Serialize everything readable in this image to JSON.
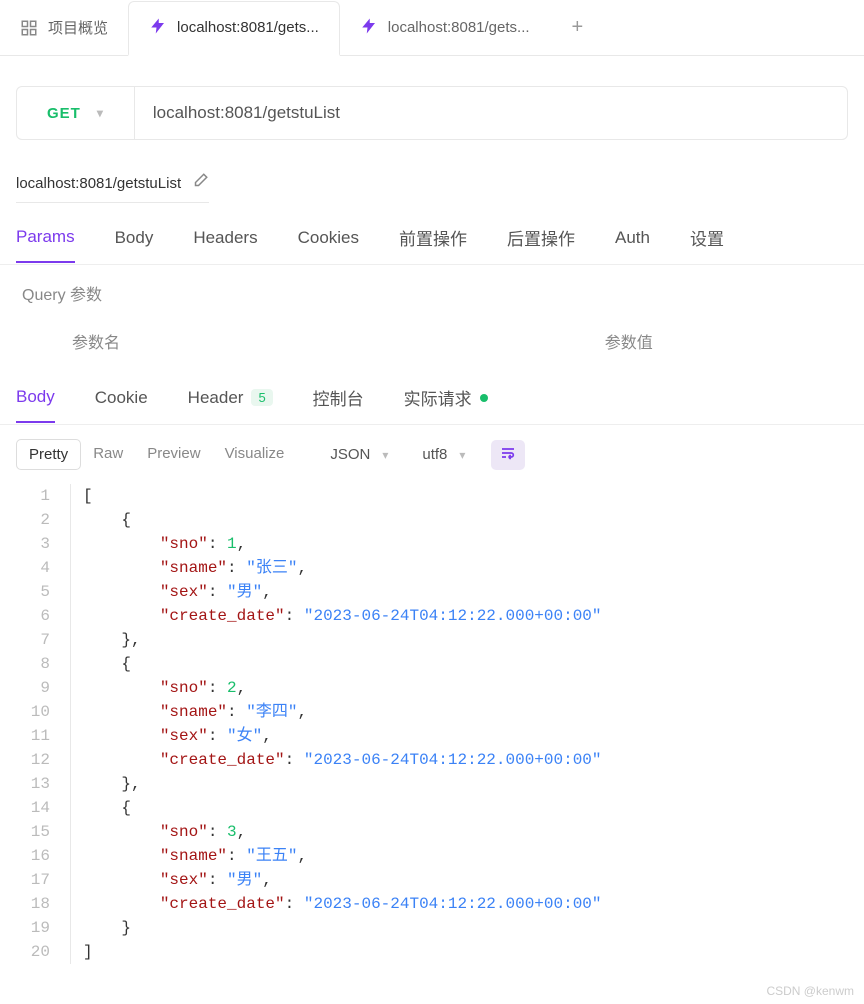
{
  "tabs": {
    "overview": "项目概览",
    "active": "localhost:8081/gets...",
    "other": "localhost:8081/gets..."
  },
  "request": {
    "method": "GET",
    "url": "localhost:8081/getstuList",
    "name": "localhost:8081/getstuList"
  },
  "subtabs": {
    "params": "Params",
    "body": "Body",
    "headers": "Headers",
    "cookies": "Cookies",
    "pre": "前置操作",
    "post": "后置操作",
    "auth": "Auth",
    "settings": "设置"
  },
  "query": {
    "section": "Query 参数",
    "col_name": "参数名",
    "col_value": "参数值"
  },
  "resp_tabs": {
    "body": "Body",
    "cookie": "Cookie",
    "header": "Header",
    "header_badge": "5",
    "console": "控制台",
    "actual": "实际请求"
  },
  "view": {
    "pretty": "Pretty",
    "raw": "Raw",
    "preview": "Preview",
    "visualize": "Visualize",
    "format": "JSON",
    "encoding": "utf8"
  },
  "json_body": [
    {
      "sno": 1,
      "sname": "张三",
      "sex": "男",
      "create_date": "2023-06-24T04:12:22.000+00:00"
    },
    {
      "sno": 2,
      "sname": "李四",
      "sex": "女",
      "create_date": "2023-06-24T04:12:22.000+00:00"
    },
    {
      "sno": 3,
      "sname": "王五",
      "sex": "男",
      "create_date": "2023-06-24T04:12:22.000+00:00"
    }
  ],
  "watermark": "CSDN @kenwm"
}
